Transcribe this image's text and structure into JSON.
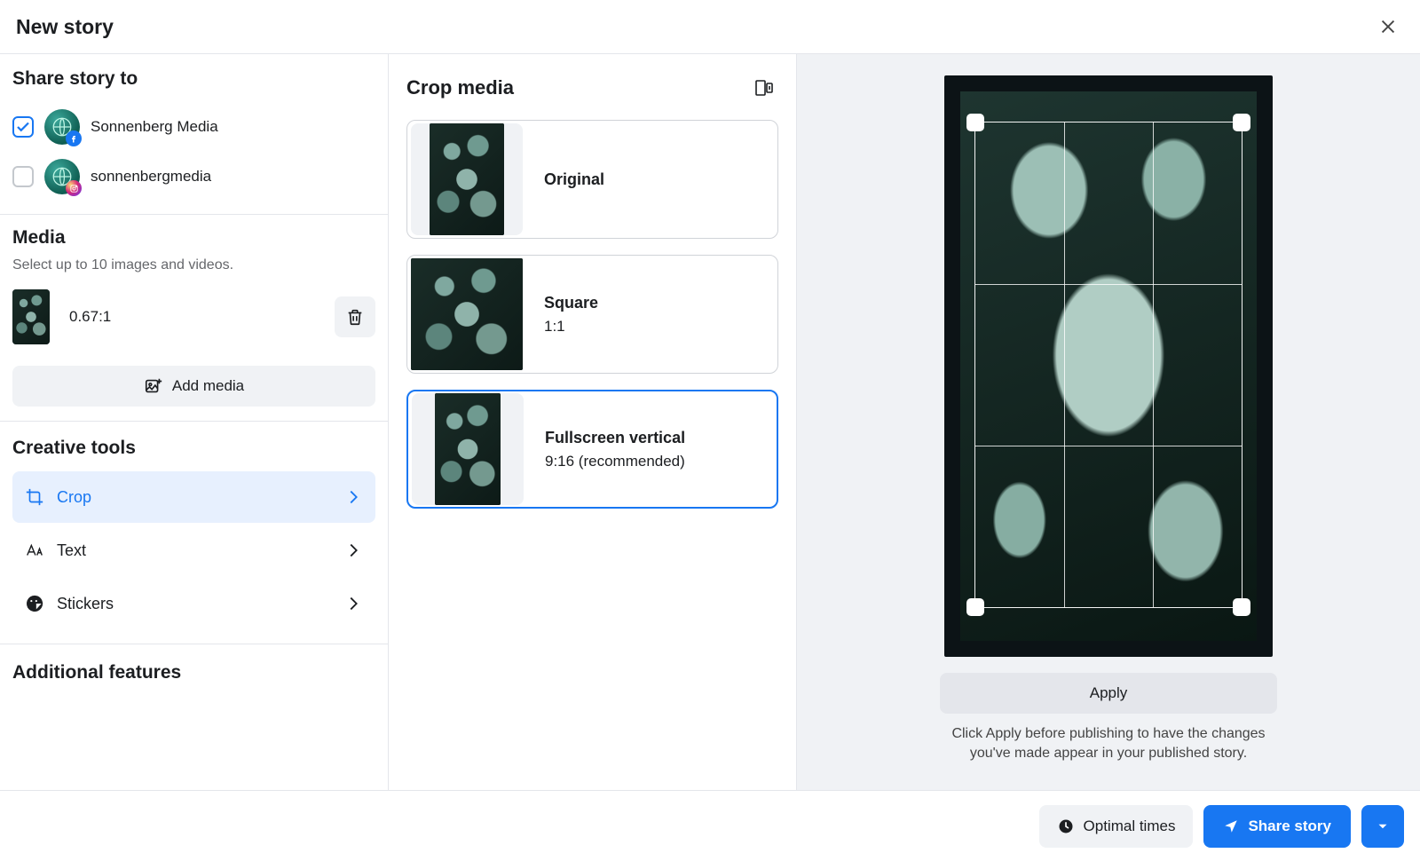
{
  "header": {
    "title": "New story"
  },
  "share": {
    "heading": "Share story to",
    "accounts": [
      {
        "name": "Sonnenberg Media",
        "network": "facebook",
        "checked": true
      },
      {
        "name": "sonnenbergmedia",
        "network": "instagram",
        "checked": false
      }
    ]
  },
  "media": {
    "heading": "Media",
    "hint": "Select up to 10 images and videos.",
    "items": [
      {
        "ratio": "0.67:1"
      }
    ],
    "add_label": "Add media"
  },
  "tools": {
    "heading": "Creative tools",
    "items": [
      {
        "id": "crop",
        "label": "Crop",
        "active": true
      },
      {
        "id": "text",
        "label": "Text",
        "active": false
      },
      {
        "id": "stickers",
        "label": "Stickers",
        "active": false
      }
    ]
  },
  "additional": {
    "heading": "Additional features"
  },
  "crop": {
    "heading": "Crop media",
    "options": [
      {
        "title": "Original",
        "sub": "",
        "selected": false
      },
      {
        "title": "Square",
        "sub": "1:1",
        "selected": false
      },
      {
        "title": "Fullscreen vertical",
        "sub": "9:16 (recommended)",
        "selected": true
      }
    ]
  },
  "preview": {
    "apply_label": "Apply",
    "hint": "Click Apply before publishing to have the changes you've made appear in your published story."
  },
  "footer": {
    "optimal_label": "Optimal times",
    "share_label": "Share story"
  },
  "colors": {
    "accent": "#1877f2"
  }
}
